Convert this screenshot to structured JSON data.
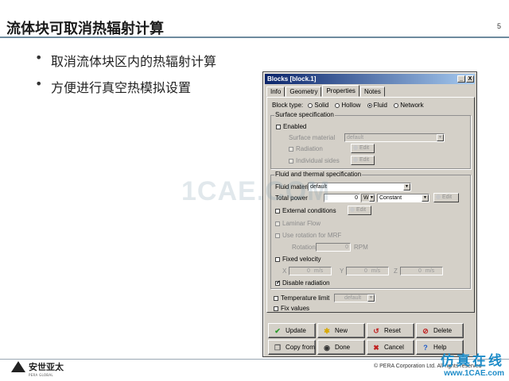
{
  "slide": {
    "title": "流体块可取消热辐射计算",
    "page_number": "5",
    "bullets": [
      "取消流体块区内的热辐射计算",
      "方便进行真空热模拟设置"
    ],
    "watermark": "1CAE.COM",
    "logo": {
      "cn": "安世亚太",
      "en": "PERA GLOBAL"
    },
    "copyright": "© PERA Corporation Ltd. All rights reserved",
    "site": {
      "cn": "仿真在线",
      "url": "www.1CAE.com"
    }
  },
  "dialog": {
    "title": "Blocks [block.1]",
    "window_buttons": [
      "_",
      "X"
    ],
    "tabs": [
      "Info",
      "Geometry",
      "Properties",
      "Notes"
    ],
    "active_tab": "Properties",
    "block_type": {
      "label": "Block type:",
      "options": [
        "Solid",
        "Hollow",
        "Fluid",
        "Network"
      ],
      "selected": "Fluid"
    },
    "surface": {
      "group_label": "Surface specification",
      "enabled_label": "Enabled",
      "material_label": "Surface material",
      "material_value": "default",
      "radiation_label": "Radiation",
      "individual_label": "Individual sides",
      "edit_label": "Edit"
    },
    "fluid": {
      "group_label": "Fluid and thermal specification",
      "material_label": "Fluid material",
      "material_value": "default",
      "power_label": "Total power",
      "power_value": "0",
      "power_unit": "W",
      "power_mode": "Constant",
      "edit_label": "Edit",
      "external_label": "External conditions",
      "laminar_label": "Laminar Flow",
      "rotation_label": "Use rotation for MRF",
      "rotation_sub_label": "Rotation",
      "rotation_value": "0",
      "rotation_unit": "RPM",
      "fixed_velocity_label": "Fixed velocity",
      "velocity": [
        {
          "axis": "X",
          "value": "0",
          "unit": "m/s"
        },
        {
          "axis": "Y",
          "value": "0",
          "unit": "m/s"
        },
        {
          "axis": "Z",
          "value": "0",
          "unit": "m/s"
        }
      ],
      "disable_radiation_label": "Disable radiation",
      "disable_radiation_checked": true
    },
    "temperature_limit_label": "Temperature limit",
    "temperature_limit_value": "default",
    "fix_values_label": "Fix values",
    "buttons": {
      "update": "Update",
      "new": "New",
      "reset": "Reset",
      "delete": "Delete",
      "copy_from": "Copy from",
      "done": "Done",
      "cancel": "Cancel",
      "help": "Help"
    }
  },
  "colors": {
    "dialog_face": "#d4d0c8",
    "titlebar_start": "#0a246a",
    "titlebar_end": "#a6caf0",
    "site_blue": "#1e8cc8"
  }
}
